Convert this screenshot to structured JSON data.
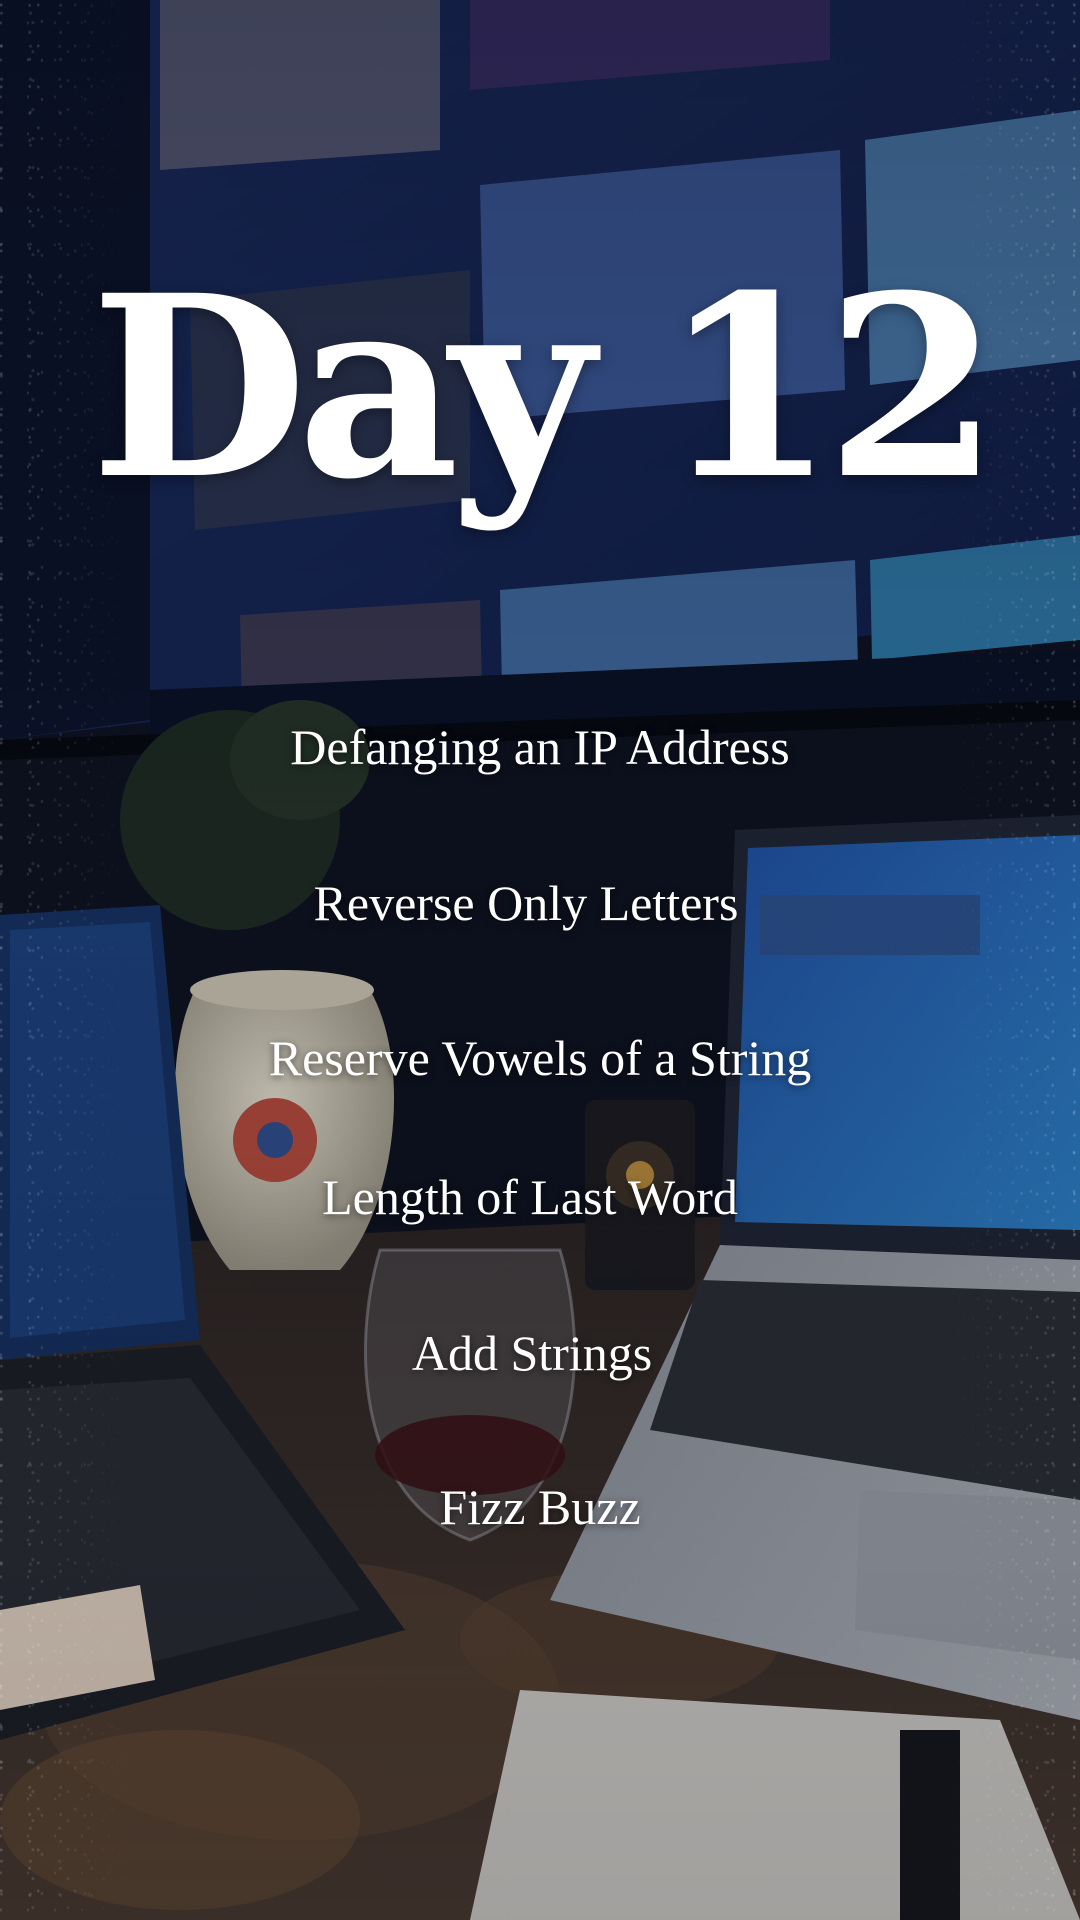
{
  "title": "Day 12",
  "topics": [
    "Defanging an IP Address",
    "Reverse Only Letters",
    "Reserve Vowels of a String",
    "Length of Last Word",
    "Add Strings",
    "Fizz Buzz"
  ],
  "colors": {
    "text": "#ffffff",
    "background": "#0b0f1c"
  }
}
